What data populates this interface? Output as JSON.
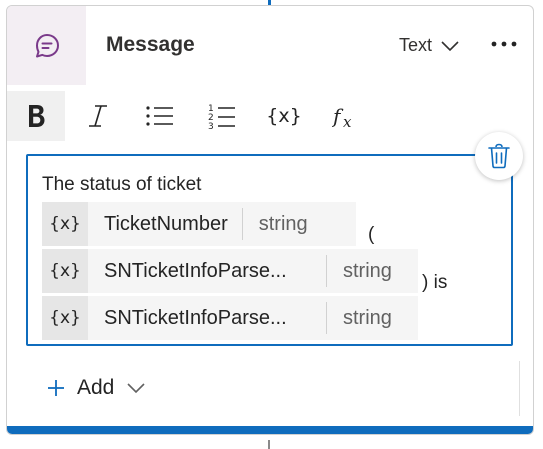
{
  "header": {
    "title": "Message",
    "type_label": "Text"
  },
  "editor": {
    "text_before": "The status of ticket",
    "paren_open": "(",
    "text_after": ") is",
    "variables": [
      {
        "icon": "{x}",
        "name": "TicketNumber",
        "type": "string"
      },
      {
        "icon": "{x}",
        "name": "SNTicketInfoParse...",
        "type": "string"
      },
      {
        "icon": "{x}",
        "name": "SNTicketInfoParse...",
        "type": "string"
      }
    ]
  },
  "add": {
    "label": "Add"
  },
  "toolbar": {
    "variable_glyph": "{x}"
  },
  "colors": {
    "accent": "#0f6cbd",
    "icon_purple": "#7a3a8a",
    "icon_bg": "#f3eef3"
  }
}
